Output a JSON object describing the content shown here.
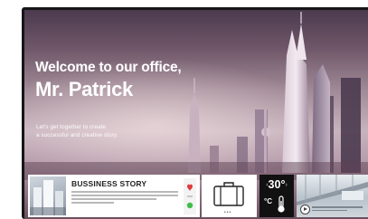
{
  "welcome": {
    "line1": "Welcome to our office,",
    "line2": "Mr. Patrick"
  },
  "subtitle": {
    "line1": "Let's get together to create",
    "line2": "a successful and creative story."
  },
  "story_card": {
    "title": "BUSSINESS STORY"
  },
  "weather": {
    "temperature": "30°",
    "unit": "°C",
    "prev_symbol": "‹",
    "next_symbol": "›",
    "icon": "thermometer-icon"
  },
  "carousel": {
    "dots": "•••"
  },
  "icons": [
    "suitcase-icon",
    "play-icon",
    "thermometer-icon"
  ],
  "colors": {
    "accent_red": "#e03a3e",
    "accent_green": "#3fbf4a",
    "bezel": "#161618"
  }
}
